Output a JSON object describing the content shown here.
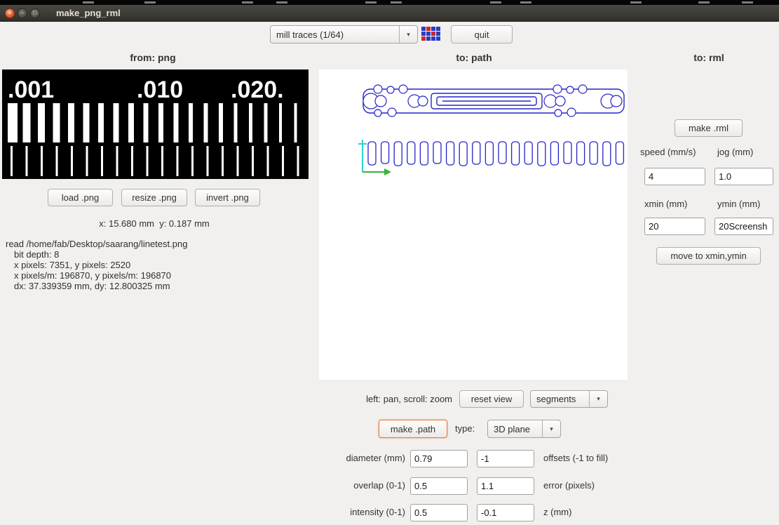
{
  "window": {
    "title": "make_png_rml",
    "top_marks": [
      118,
      206,
      345,
      394,
      521,
      557,
      699,
      742,
      899,
      996,
      1058
    ]
  },
  "toolbar": {
    "process_value": "mill traces (1/64)",
    "quit_label": "quit",
    "icon_colors": [
      "#2a3cc4",
      "#d2232a",
      "#2a3cc4",
      "#2a3cc4",
      "#2a3cc4",
      "#2a3cc4",
      "#d2232a",
      "#2a3cc4",
      "#d2232a",
      "#2a3cc4",
      "#2a3cc4",
      "#2a3cc4"
    ]
  },
  "from_png": {
    "header": "from: png",
    "preview": {
      "labels": [
        ".001",
        ".010",
        ".020."
      ],
      "top_bar_widths": [
        14,
        11,
        10,
        10,
        9,
        9,
        8,
        8,
        8,
        7,
        7,
        7,
        6,
        6,
        6,
        5,
        5,
        5,
        4,
        4
      ],
      "bottom_bar_count": 20
    },
    "buttons": {
      "load": "load .png",
      "resize": "resize .png",
      "invert": "invert .png"
    },
    "cursor_readout": "x: 15.680 mm  y: 0.187 mm",
    "info_lines": [
      "read /home/fab/Desktop/saarang/linetest.png",
      "bit depth: 8",
      "x pixels: 7351, y pixels: 2520",
      "x pixels/m: 196870, y pixels/m: 196870",
      "dx: 37.339359 mm, dy: 12.800325 mm"
    ]
  },
  "to_path": {
    "header": "to: path",
    "hint": "left: pan, scroll: zoom",
    "reset_view_label": "reset view",
    "view_mode_value": "segments",
    "make_path_label": "make .path",
    "type_label": "type:",
    "type_value": "3D plane",
    "pad_heights": [
      33,
      31,
      34,
      32,
      33,
      31,
      33,
      34,
      32,
      33,
      31,
      33,
      32,
      34,
      33,
      31,
      33,
      32,
      34,
      32
    ],
    "params": [
      {
        "label": "diameter (mm)",
        "value": "0.79",
        "value2": "-1",
        "label2": "offsets (-1 to fill)"
      },
      {
        "label": "overlap (0-1)",
        "value": "0.5",
        "value2": "1.1",
        "label2": "error (pixels)"
      },
      {
        "label": "intensity (0-1)",
        "value": "0.5",
        "value2": "-0.1",
        "label2": "z (mm)"
      }
    ]
  },
  "to_rml": {
    "header": "to: rml",
    "make_rml_label": "make .rml",
    "speed_label": "speed (mm/s)",
    "jog_label": "jog (mm)",
    "speed_value": "4",
    "jog_value": "1.0",
    "xmin_label": "xmin (mm)",
    "ymin_label": "ymin (mm)",
    "xmin_value": "20",
    "ymin_value": "20Screensh",
    "move_label": "move to xmin,ymin"
  },
  "colors": {
    "path_blue": "#2525c8",
    "axis_cyan": "#2bd3d3",
    "axis_green": "#35b435",
    "focus_orange": "#e8794a",
    "titlebar": "#3a3833",
    "background": "#f1f0ee"
  }
}
